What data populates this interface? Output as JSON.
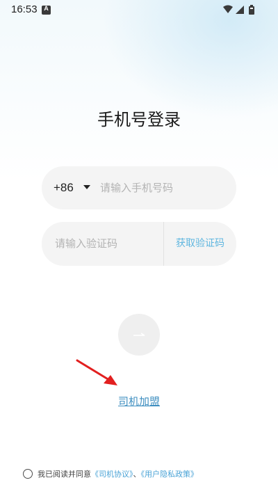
{
  "status_bar": {
    "time": "16:53",
    "notification_letter": "A",
    "icons": [
      "wifi-icon",
      "signal-icon",
      "battery-icon"
    ]
  },
  "login": {
    "title": "手机号登录",
    "country_code": "+86",
    "phone_placeholder": "请输入手机号码",
    "code_placeholder": "请输入验证码",
    "get_code_label": "获取验证码",
    "submit_icon": "arrow-right-icon"
  },
  "driver_join_label": "司机加盟",
  "agreement": {
    "prefix": "我已阅读并同意",
    "driver_agreement": "《司机协议》",
    "separator": "、",
    "privacy_policy": "《用户隐私政策》"
  },
  "colors": {
    "link_blue": "#3f8fc0",
    "get_code_blue": "#5fb6df",
    "annotation_red": "#e21f1f"
  }
}
